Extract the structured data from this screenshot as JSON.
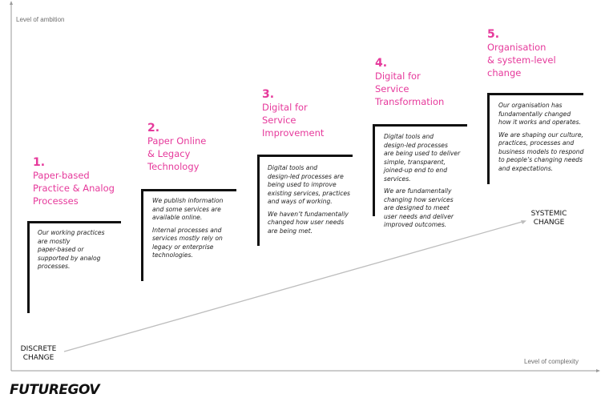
{
  "axes": {
    "y_label": "Level of ambition",
    "x_label": "Level of complexity"
  },
  "trend": {
    "start_label": "DISCRETE\nCHANGE",
    "end_label": "SYSTEMIC\nCHANGE"
  },
  "stages": [
    {
      "number": "1.",
      "title": "Paper-based\nPractice & Analog\nProcesses",
      "paragraphs": [
        "Our working practices\nare mostly\npaper-based or\nsupported by analog\nprocesses."
      ]
    },
    {
      "number": "2.",
      "title": "Paper Online\n& Legacy\nTechnology",
      "paragraphs": [
        "We publish information\nand some services are\navailable online.",
        "Internal processes and\nservices mostly rely on\nlegacy or enterprise\ntechnologies."
      ]
    },
    {
      "number": "3.",
      "title": "Digital for\nService\nImprovement",
      "paragraphs": [
        "Digital tools and\ndesign-led processes are\nbeing used to improve\nexisting services, practices\nand ways of working.",
        "We haven’t fundamentally\nchanged how user needs\nare being met."
      ]
    },
    {
      "number": "4.",
      "title": "Digital for\nService\nTransformation",
      "paragraphs": [
        "Digital tools and\ndesign-led processes\nare being used to deliver\nsimple, transparent,\njoined-up end to end\nservices.",
        "We are fundamentally\nchanging how services\nare designed to meet\nuser needs and deliver\nimproved outcomes."
      ]
    },
    {
      "number": "5.",
      "title": "Organisation\n& system-level\nchange",
      "paragraphs": [
        "Our organisation has\nfundamentally changed\nhow it works and operates.",
        "We are shaping our culture,\npractices, processes and\nbusiness models to respond\nto people’s changing needs\nand expectations."
      ]
    }
  ],
  "brand": {
    "logo_text": "FUTUREGOV"
  },
  "colors": {
    "accent": "#e6399b",
    "bracket": "#111111",
    "axis": "#9a9a9a",
    "trend_line": "#bdbdbd"
  }
}
